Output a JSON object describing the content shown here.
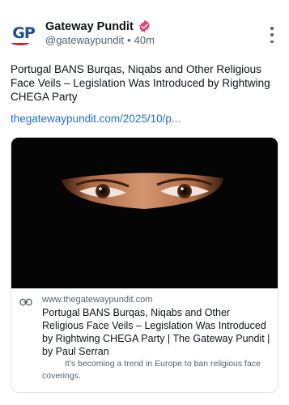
{
  "post": {
    "avatar_text": "GP",
    "display_name": "Gateway Pundit",
    "handle": "@gatewaypundit",
    "separator": "•",
    "time": "40m",
    "text": "Portugal BANS Burqas, Niqabs and Other Religious Face Veils – Legislation Was Introduced by Rightwing CHEGA Party",
    "link": "thegatewaypundit.com/2025/10/p..."
  },
  "card": {
    "domain": "www.thegatewaypundit.com",
    "title": "Portugal BANS Burqas, Niqabs and Other Religious Face Veils – Legislation Was Introduced by Rightwing CHEGA Party | The Gateway Pundit | by Paul Serran",
    "description": "It's becoming a trend in Europe to ban religious face coverings."
  },
  "colors": {
    "verified": "#e63d6f",
    "link": "#1d6fd8",
    "brand_blue": "#1f4e8c",
    "brand_red": "#c8262b"
  },
  "icons": [
    "verified-badge-icon",
    "more-options-icon",
    "link-icon"
  ]
}
